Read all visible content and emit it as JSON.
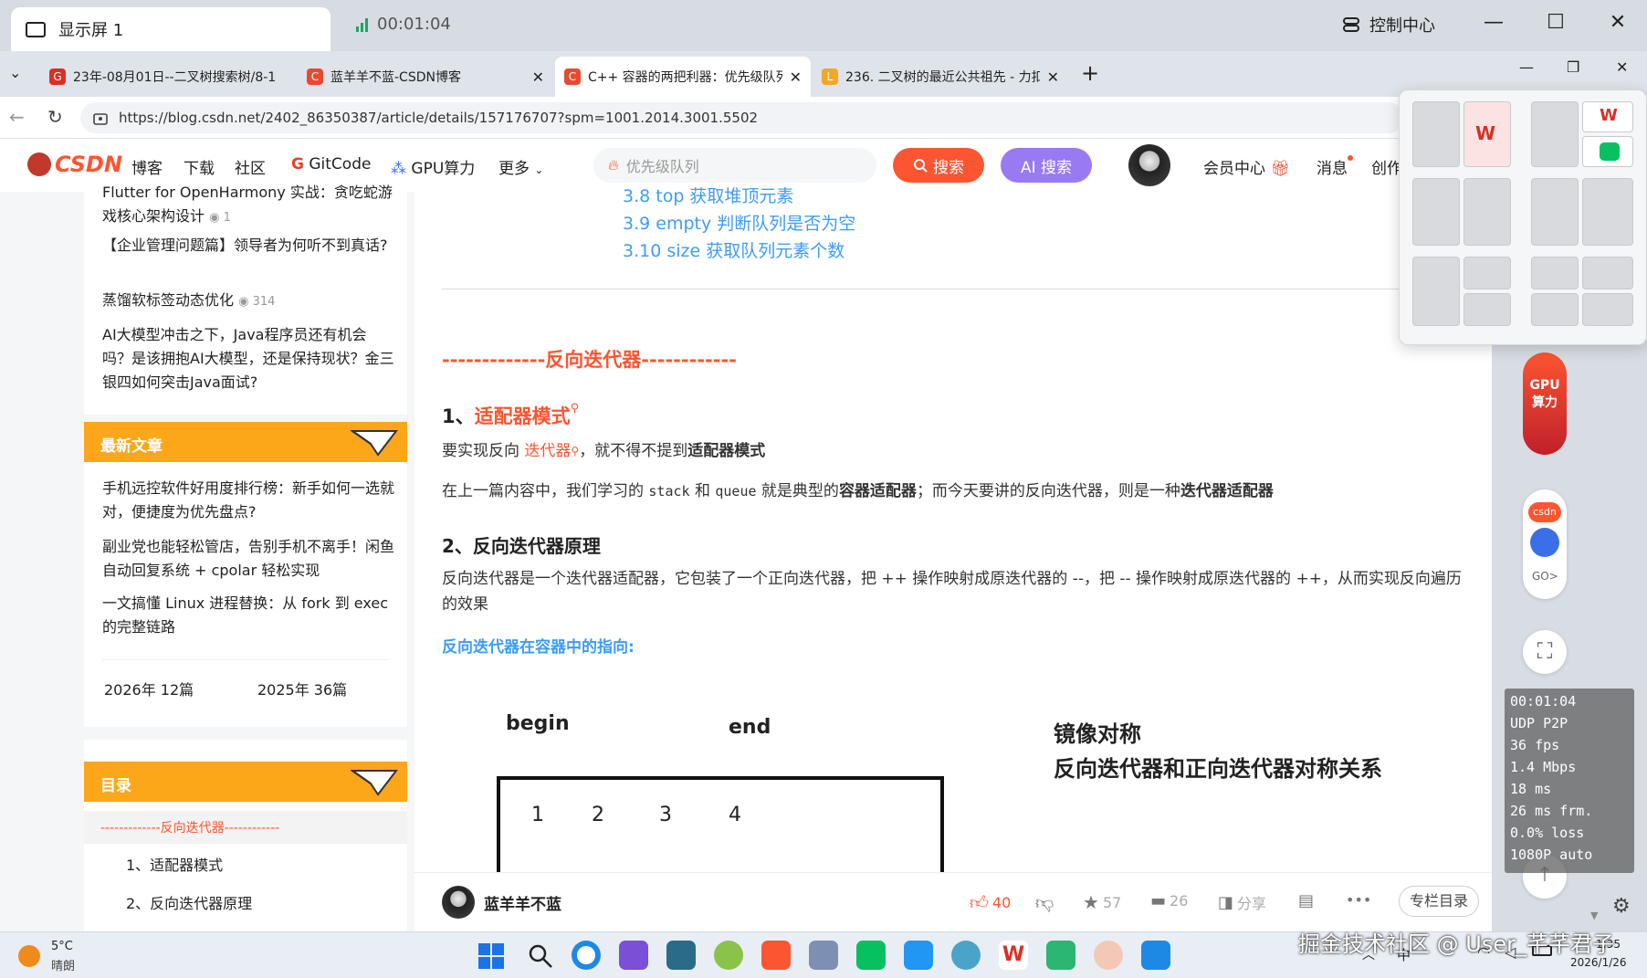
{
  "shell": {
    "tab_title": "显示屏 1",
    "timer": "00:01:04",
    "control_center": "控制中心"
  },
  "browser": {
    "tabs": [
      {
        "title": "23年-08月01日--二叉树搜索树/8-1",
        "icon": "G"
      },
      {
        "title": "蓝羊羊不蓝-CSDN博客",
        "icon": "C"
      },
      {
        "title": "C++ 容器的两把利器：优先级队列",
        "icon": "C"
      },
      {
        "title": "236. 二叉树的最近公共祖先 - 力扣",
        "icon": "L"
      }
    ],
    "url": "https://blog.csdn.net/2402_86350387/article/details/157176707?spm=1001.2014.3001.5502"
  },
  "csdn": {
    "logo": "CSDN",
    "nav": [
      "博客",
      "下载",
      "社区",
      "GitCode",
      "GPU算力",
      "更多"
    ],
    "search_placeholder": "优先级队列",
    "search_btn": "搜索",
    "ai_btn": "AI 搜索",
    "member": "会员中心",
    "msg": "消息",
    "create": "创作"
  },
  "left": {
    "top_items": [
      {
        "text": "Flutter for OpenHarmony 实战：贪吃蛇游戏核心架构设计",
        "count": "1"
      },
      {
        "text": "【企业管理问题篇】领导者为何听不到真话?",
        "count": ""
      },
      {
        "text": "蒸馏软标签动态优化",
        "count": "314"
      },
      {
        "text": "AI大模型冲击之下，Java程序员还有机会吗？是该拥抱AI大模型，还是保持现状？金三银四如何突击Java面试?",
        "count": ""
      }
    ],
    "latest_title": "最新文章",
    "latest": [
      "手机远控软件好用度排行榜：新手如何一选就对，便捷度为优先盘点?",
      "副业党也能轻松管店，告别手机不离手！闲鱼自动回复系统 + cpolar 轻松实现",
      "一文搞懂 Linux 进程替换：从 fork 到 exec 的完整链路"
    ],
    "archive": [
      "2026年  12篇",
      "2025年  36篇"
    ],
    "toc_title": "目录",
    "toc": [
      "-------------反向迭代器------------",
      "1、适配器模式",
      "2、反向迭代器原理"
    ]
  },
  "article": {
    "toc": [
      "3.8 top 获取堆顶元素",
      "3.9 empty 判断队列是否为空",
      "3.10 size 获取队列元素个数"
    ],
    "section": "-------------反向迭代器------------",
    "h_1_num": "1、",
    "h_1_link": "适配器模式",
    "p1_a": "要实现反向 ",
    "p1_link": "迭代器",
    "p1_b": "，就不得不提到",
    "p1_bold": "适配器模式",
    "p2_a": "在上一篇内容中，我们学习的 ",
    "p2_c1": "stack",
    "p2_and": " 和 ",
    "p2_c2": "queue",
    "p2_b": " 就是典型的",
    "p2_bold1": "容器适配器",
    "p2_c": "；而今天要讲的反向迭代器，则是一种",
    "p2_bold2": "迭代器适配器",
    "h_2": "2、反向迭代器原理",
    "p3": "反向迭代器是一个迭代器适配器，它包装了一个正向迭代器，把 ++ 操作映射成原迭代器的 --，把 -- 操作映射成原迭代器的 ++，从而实现反向遍历的效果",
    "blue_h": "反向迭代器在容器中的指向:",
    "fig": {
      "begin": "begin",
      "end": "end",
      "cells": [
        "1",
        "2",
        "3",
        "4"
      ],
      "mirror": "镜像对称",
      "relation": "反向迭代器和正向迭代器对称关系"
    },
    "author": "蓝羊羊不蓝",
    "likes": "40",
    "stars": "57",
    "comments": "26",
    "share": "分享",
    "column_toc": "专栏目录"
  },
  "side": {
    "gpu": "GPU\n算力",
    "csdn_badge": "csdn",
    "go": "GO>"
  },
  "stats": [
    "00:01:04",
    "UDP P2P",
    "36 fps",
    "1.4 Mbps",
    "18 ms",
    "26 ms frm.",
    "0.0% loss",
    "1080P auto"
  ],
  "taskbar": {
    "temp": "5°C",
    "weather": "晴朗",
    "time": "1:35",
    "date": "2026/1/26",
    "ime": "中"
  },
  "watermark": "掘金技术社区 @ User_芊芊君子"
}
